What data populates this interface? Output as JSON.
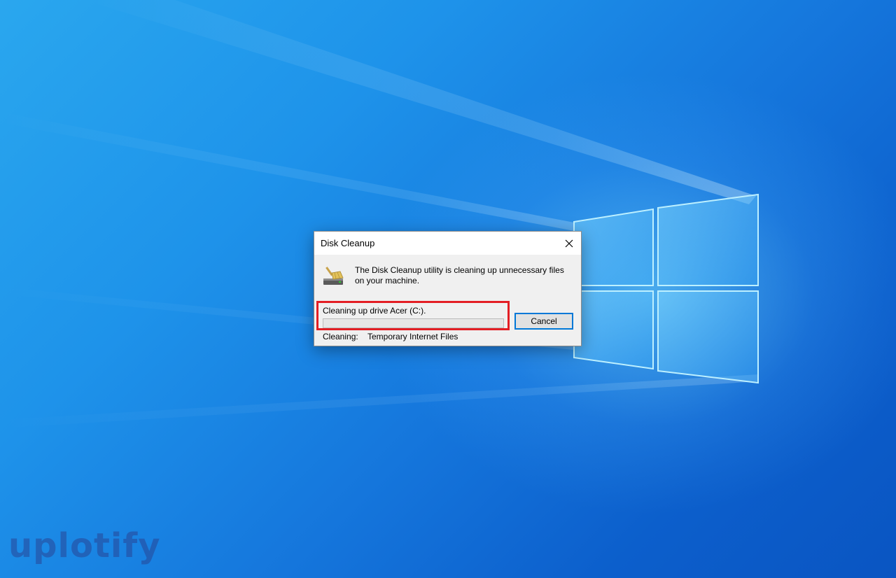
{
  "dialog": {
    "title": "Disk Cleanup",
    "close_icon": "close-icon",
    "app_icon": "disk-cleanup-broom-icon",
    "message": "The Disk Cleanup utility is cleaning up unnecessary files on your machine.",
    "progress_label": "Cleaning up drive Acer (C:).",
    "progress_value": 0,
    "cancel_label": "Cancel",
    "status_label": "Cleaning:",
    "status_value": "Temporary Internet Files"
  },
  "colors": {
    "highlight": "#e31e24",
    "button_focus": "#0078d7",
    "desktop_blue": "#1576dc"
  },
  "watermark": {
    "text": "uplotify"
  }
}
